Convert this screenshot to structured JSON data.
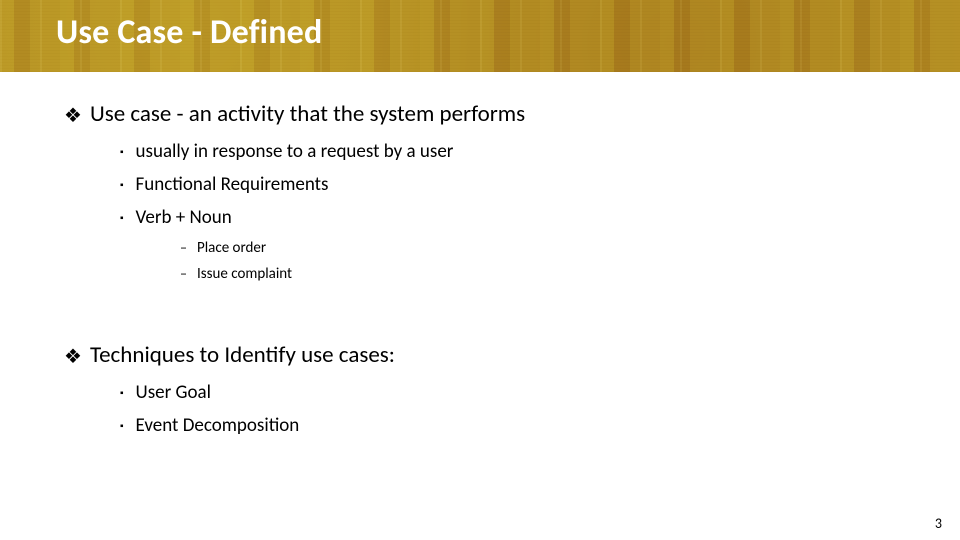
{
  "slide": {
    "title": "Use Case - Defined",
    "bullets": [
      {
        "text": "Use case - an activity that the system performs",
        "children": [
          {
            "text": "usually in response to a request by a user"
          },
          {
            "text": "Functional Requirements"
          },
          {
            "text": "Verb + Noun",
            "children": [
              {
                "text": "Place order"
              },
              {
                "text": "Issue complaint"
              }
            ]
          }
        ]
      },
      {
        "text": "Techniques to Identify use cases:",
        "children": [
          {
            "text": "User Goal"
          },
          {
            "text": "Event Decomposition"
          }
        ]
      }
    ],
    "page_number": "3"
  },
  "glyphs": {
    "diamond": "❖",
    "square": "▪",
    "dash": "–"
  }
}
